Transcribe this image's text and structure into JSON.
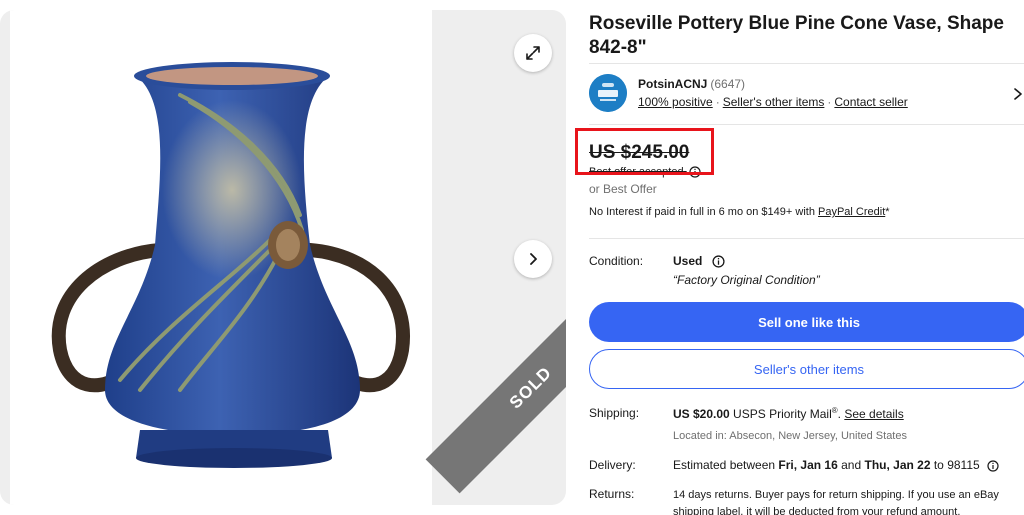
{
  "listing": {
    "title": "Roseville Pottery Blue Pine Cone Vase, Shape 842-8\"",
    "sold_badge": "SOLD"
  },
  "gallery": {
    "expand_icon": "expand-arrows-icon",
    "next_icon": "chevron-right-icon"
  },
  "seller": {
    "name": "PotsinACNJ",
    "feedback_count": "(6647)",
    "positive": "100% positive",
    "other_items": "Seller's other items",
    "contact": "Contact seller",
    "separator": "·",
    "logo_icon": "seller-store-logo-icon"
  },
  "price": {
    "amount": "US $245.00",
    "best_offer_accepted": "Best offer accepted",
    "or_best_offer": "or Best Offer"
  },
  "financing": {
    "text": "No Interest if paid in full in 6 mo on $149+ with ",
    "link": "PayPal Credit",
    "suffix": "*"
  },
  "condition": {
    "label": "Condition:",
    "value": "Used",
    "quote": "“Factory Original Condition”"
  },
  "buttons": {
    "sell_one": "Sell one like this",
    "sellers_other": "Seller's other items"
  },
  "shipping": {
    "label": "Shipping:",
    "amount": "US $20.00",
    "service": " USPS Priority Mail",
    "reg": "®",
    "dot": ". ",
    "details_link": "See details",
    "location": "Located in: Absecon, New Jersey, United States"
  },
  "delivery": {
    "label": "Delivery:",
    "prefix": "Estimated between ",
    "date1": "Fri, Jan 16",
    "and": " and ",
    "date2": "Thu, Jan 22",
    "suffix": " to 98115"
  },
  "returns": {
    "label": "Returns:",
    "text": "14 days returns. Buyer pays for return shipping. If you use an eBay shipping label, it will be deducted from your refund amount."
  },
  "colors": {
    "accent": "#3665f3",
    "highlight": "#e8141b",
    "sold_ribbon": "#767676",
    "vase": "#2b4f9c"
  }
}
